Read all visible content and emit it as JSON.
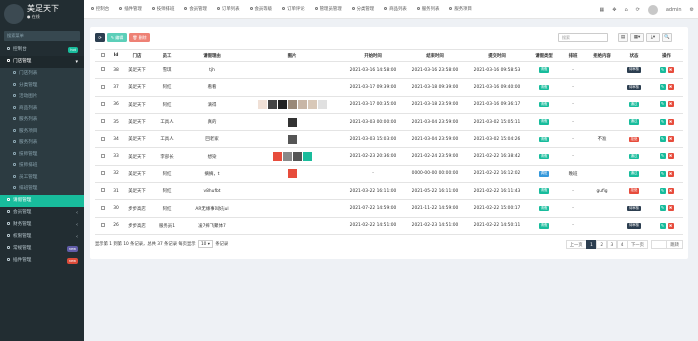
{
  "brand": {
    "title": "美足天下",
    "subtitle": "● 在线"
  },
  "search": {
    "placeholder": "搜索菜单"
  },
  "nav": [
    {
      "label": "控制台",
      "badge": "hot",
      "badge_color": "#18bc9c",
      "type": "top"
    },
    {
      "label": "门店管理",
      "type": "active",
      "caret": "▾"
    },
    {
      "label": "门店列表",
      "type": "child"
    },
    {
      "label": "分类管理",
      "type": "child"
    },
    {
      "label": "活动图片",
      "type": "child"
    },
    {
      "label": "商品列表",
      "type": "child"
    },
    {
      "label": "服务列表",
      "type": "child"
    },
    {
      "label": "服务项目",
      "type": "child"
    },
    {
      "label": "服务列表",
      "type": "child"
    },
    {
      "label": "技师管理",
      "type": "child"
    },
    {
      "label": "技师排班",
      "type": "child"
    },
    {
      "label": "员工管理",
      "type": "child"
    },
    {
      "label": "排班管理",
      "type": "child"
    },
    {
      "label": "请假管理",
      "type": "teal"
    },
    {
      "label": "会员管理",
      "type": "top",
      "caret": "‹"
    },
    {
      "label": "财务管理",
      "type": "top",
      "caret": "‹"
    },
    {
      "label": "权限管理",
      "type": "top",
      "caret": "‹"
    },
    {
      "label": "常规管理",
      "badge": "new",
      "badge_color": "#605ca8",
      "type": "top"
    },
    {
      "label": "插件管理",
      "badge": "new",
      "badge_color": "#dd4b39",
      "type": "top"
    }
  ],
  "topbar": {
    "tabs": [
      "控制台",
      "插件管理",
      "技师排班",
      "会员管理",
      "订单列表",
      "会员等级",
      "订单评论",
      "管理员管理",
      "分类管理",
      "商品列表",
      "服务列表",
      "服务项目"
    ],
    "right_icons": [
      "▦",
      "✥",
      "⌂",
      "⟳"
    ],
    "user": "admin"
  },
  "toolbar": {
    "refresh": "⟳",
    "edit": "✎ 编辑",
    "delete": "🗑 删除",
    "search_placeholder": "搜索",
    "view_icons": [
      "▤",
      "▦▾",
      "⤓▾",
      "🔍"
    ]
  },
  "table": {
    "headers": [
      "",
      "Id",
      "门店",
      "员工",
      "请假理由",
      "图片",
      "开始时间",
      "结束时间",
      "提交时间",
      "请假类型",
      "排班",
      "拒绝内容",
      "状态",
      "操作"
    ],
    "rows": [
      {
        "id": "38",
        "store": "美足天下",
        "staff": "雪琪",
        "reason": "tjh",
        "imgs": [],
        "start": "2021-03-16 14:58:00",
        "end": "2021-03-16 23:58:00",
        "submit": "2021-03-16 09:58:53",
        "type": "请假",
        "sched": "-",
        "reject": "",
        "status": "待审核",
        "status_color": "#2c3e50"
      },
      {
        "id": "37",
        "store": "美足天下",
        "staff": "阿红",
        "reason": "看看",
        "imgs": [],
        "start": "2021-03-17 09:39:00",
        "end": "2021-03-18 09:39:00",
        "submit": "2021-03-16 09:40:00",
        "type": "请假",
        "sched": "-",
        "reject": "",
        "status": "待审核",
        "status_color": "#2c3e50"
      },
      {
        "id": "36",
        "store": "美足天下",
        "staff": "阿红",
        "reason": "滴得",
        "imgs": [
          "#f0e0d6",
          "#444",
          "#222",
          "#998877",
          "#c8b6a6",
          "#d8c8b8",
          "#e0e0e0"
        ],
        "start": "2021-03-17 00:35:00",
        "end": "2021-03-18 23:59:00",
        "submit": "2021-03-16 09:36:17",
        "type": "请假",
        "sched": "-",
        "reject": "",
        "status": "通过",
        "status_color": "#18bc9c"
      },
      {
        "id": "35",
        "store": "美足天下",
        "staff": "工具人",
        "reason": "真的",
        "imgs": [
          "#333"
        ],
        "start": "2021-03-03 00:00:00",
        "end": "2021-03-04 23:59:00",
        "submit": "2021-03-02 15:05:11",
        "type": "请假",
        "sched": "-",
        "reject": "",
        "status": "通过",
        "status_color": "#18bc9c"
      },
      {
        "id": "34",
        "store": "美足天下",
        "staff": "工具人",
        "reason": "回老家",
        "imgs": [
          "#555"
        ],
        "start": "2021-03-03 15:03:00",
        "end": "2021-03-04 23:59:00",
        "submit": "2021-03-02 15:04:26",
        "type": "请假",
        "sched": "-",
        "reject": "不准",
        "status": "拒绝",
        "status_color": "#e74c3c"
      },
      {
        "id": "33",
        "store": "美足天下",
        "staff": "李部长",
        "reason": "想染",
        "imgs": [
          "#e74c3c",
          "#888",
          "#555",
          "#1abc9c"
        ],
        "start": "2021-02-23 20:36:00",
        "end": "2021-02-24 23:59:00",
        "submit": "2021-02-22 16:38:42",
        "type": "请假",
        "sched": "-",
        "reject": "",
        "status": "通过",
        "status_color": "#18bc9c"
      },
      {
        "id": "32",
        "store": "美足天下",
        "staff": "阿红",
        "reason": "摘摘，t",
        "imgs": [
          "#e74c3c"
        ],
        "start": "-",
        "end": "0000-00-00 00:00:00",
        "submit": "2021-02-22 16:12:02",
        "type": "调班",
        "sched": "晚班",
        "reject": "",
        "status": "通过",
        "status_color": "#18bc9c"
      },
      {
        "id": "31",
        "store": "美足天下",
        "staff": "阿红",
        "reason": "v8hufbt",
        "imgs": [],
        "start": "2021-03-22 16:11:00",
        "end": "2021-05-22 16:11:00",
        "submit": "2021-02-22 16:11:43",
        "type": "请假",
        "sched": "-",
        "reject": "gufig",
        "status": "拒绝",
        "status_color": "#e74c3c"
      },
      {
        "id": "30",
        "store": "步步高店",
        "staff": "阿红",
        "reason": "AR无缘事叫好jul",
        "imgs": [],
        "start": "2021-07-22 14:59:00",
        "end": "2021-11-22 14:59:00",
        "submit": "2021-02-22 15:00:17",
        "type": "请假",
        "sched": "-",
        "reject": "",
        "status": "待审核",
        "status_color": "#2c3e50"
      },
      {
        "id": "26",
        "store": "步步高店",
        "staff": "服务员1",
        "reason": "凌7摔飞聚体7",
        "imgs": [],
        "start": "2021-02-22 14:51:00",
        "end": "2021-02-23 14:51:00",
        "submit": "2021-02-22 14:50:11",
        "type": "请假",
        "sched": "-",
        "reject": "",
        "status": "待审核",
        "status_color": "#2c3e50"
      }
    ]
  },
  "pagination": {
    "info_a": "显示第 1 到第 10 条记录，总共 37 条记录 每页显示",
    "per_page": "10",
    "info_b": "条记录",
    "prev": "上一页",
    "pages": [
      "1",
      "2",
      "3",
      "4"
    ],
    "next": "下一页",
    "goto": "跳转"
  },
  "colors": {
    "teal": "#18bc9c",
    "red": "#e74c3c",
    "navy": "#2c3e50",
    "sidebar": "#222d32"
  }
}
